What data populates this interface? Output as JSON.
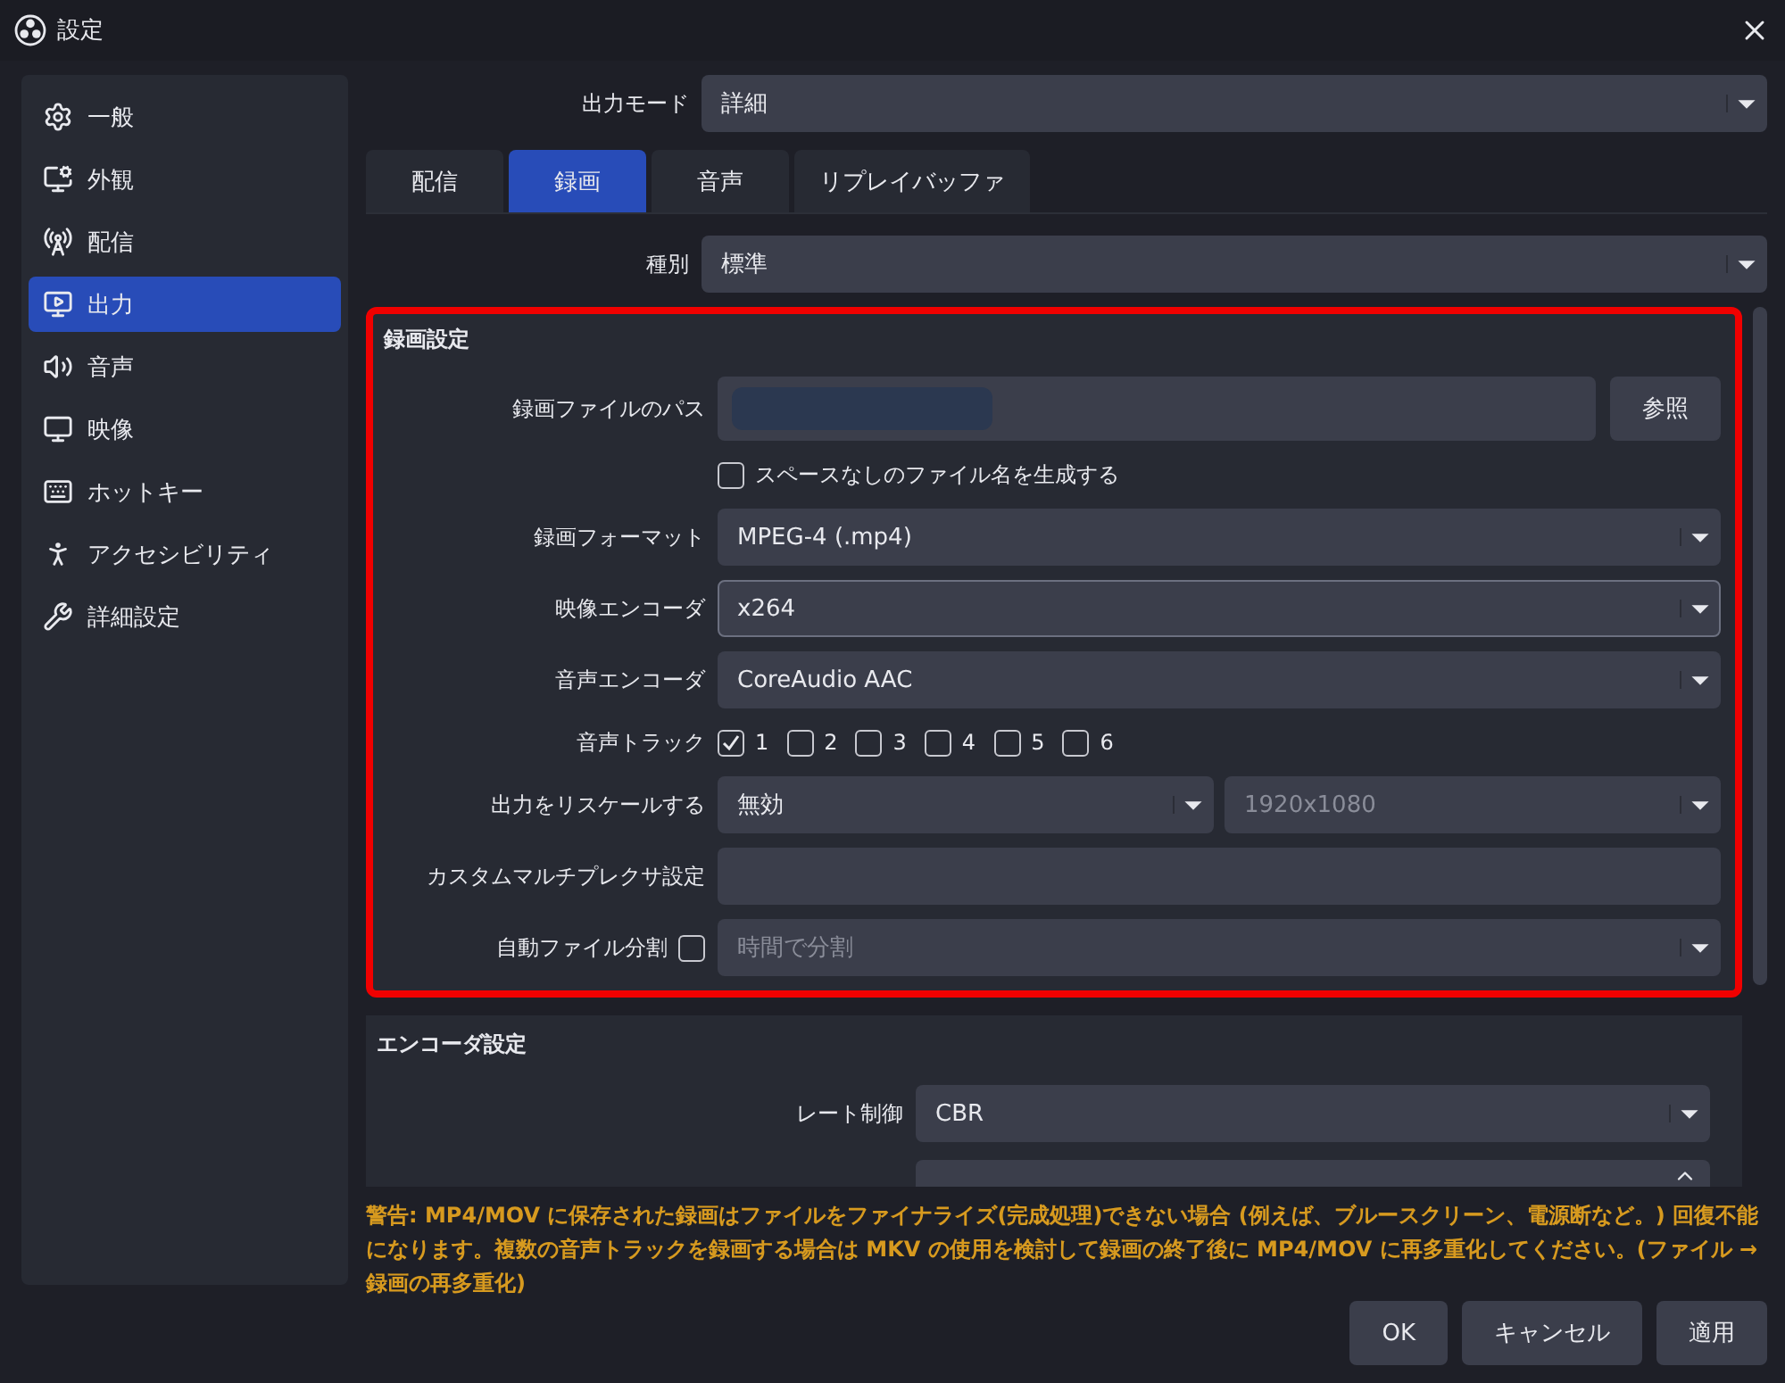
{
  "window": {
    "title": "設定"
  },
  "sidebar": {
    "items": [
      {
        "label": "一般",
        "selected": false
      },
      {
        "label": "外観",
        "selected": false
      },
      {
        "label": "配信",
        "selected": false
      },
      {
        "label": "出力",
        "selected": true
      },
      {
        "label": "音声",
        "selected": false
      },
      {
        "label": "映像",
        "selected": false
      },
      {
        "label": "ホットキー",
        "selected": false
      },
      {
        "label": "アクセシビリティ",
        "selected": false
      },
      {
        "label": "詳細設定",
        "selected": false
      }
    ]
  },
  "output_mode": {
    "label": "出力モード",
    "value": "詳細"
  },
  "tabs": [
    {
      "label": "配信",
      "selected": false
    },
    {
      "label": "録画",
      "selected": true
    },
    {
      "label": "音声",
      "selected": false
    },
    {
      "label": "リプレイバッファ",
      "selected": false
    }
  ],
  "type": {
    "label": "種別",
    "value": "標準"
  },
  "recording_settings": {
    "title": "録画設定",
    "highlighted": true,
    "rows": [
      {
        "kind": "path",
        "label": "録画ファイルのパス",
        "button": "参照"
      },
      {
        "kind": "checkbox",
        "label": "スペースなしのファイル名を生成する",
        "checked": false
      },
      {
        "kind": "select",
        "label": "録画フォーマット",
        "value": "MPEG-4 (.mp4)",
        "focused": false
      },
      {
        "kind": "select",
        "label": "映像エンコーダ",
        "value": "x264",
        "focused": true
      },
      {
        "kind": "select",
        "label": "音声エンコーダ",
        "value": "CoreAudio AAC",
        "focused": false
      },
      {
        "kind": "tracks",
        "label": "音声トラック",
        "tracks": [
          {
            "label": "1",
            "checked": true
          },
          {
            "label": "2",
            "checked": false
          },
          {
            "label": "3",
            "checked": false
          },
          {
            "label": "4",
            "checked": false
          },
          {
            "label": "5",
            "checked": false
          },
          {
            "label": "6",
            "checked": false
          }
        ]
      },
      {
        "kind": "rescale",
        "label": "出力をリスケールする",
        "value": "無効",
        "resolution": "1920x1080",
        "disabled": true
      },
      {
        "kind": "text",
        "label": "カスタムマルチプレクサ設定"
      },
      {
        "kind": "split",
        "label": "自動ファイル分割",
        "checked": false,
        "value": "時間で分割",
        "disabled": true
      }
    ]
  },
  "encoder_settings": {
    "title": "エンコーダ設定",
    "rows": [
      {
        "kind": "select",
        "label": "レート制御",
        "value": "CBR",
        "focused": false
      },
      {
        "kind": "spin"
      }
    ]
  },
  "warning": "警告: MP4/MOV に保存された録画はファイルをファイナライズ(完成処理)できない場合 (例えば、ブルースクリーン、電源断など。) 回復不能になります。複数の音声トラックを録画する場合は MKV の使用を検討して録画の終了後に MP4/MOV に再多重化してください。(ファイル → 録画の再多重化)",
  "buttons": [
    {
      "label": "OK"
    },
    {
      "label": "キャンセル"
    },
    {
      "label": "適用"
    }
  ]
}
